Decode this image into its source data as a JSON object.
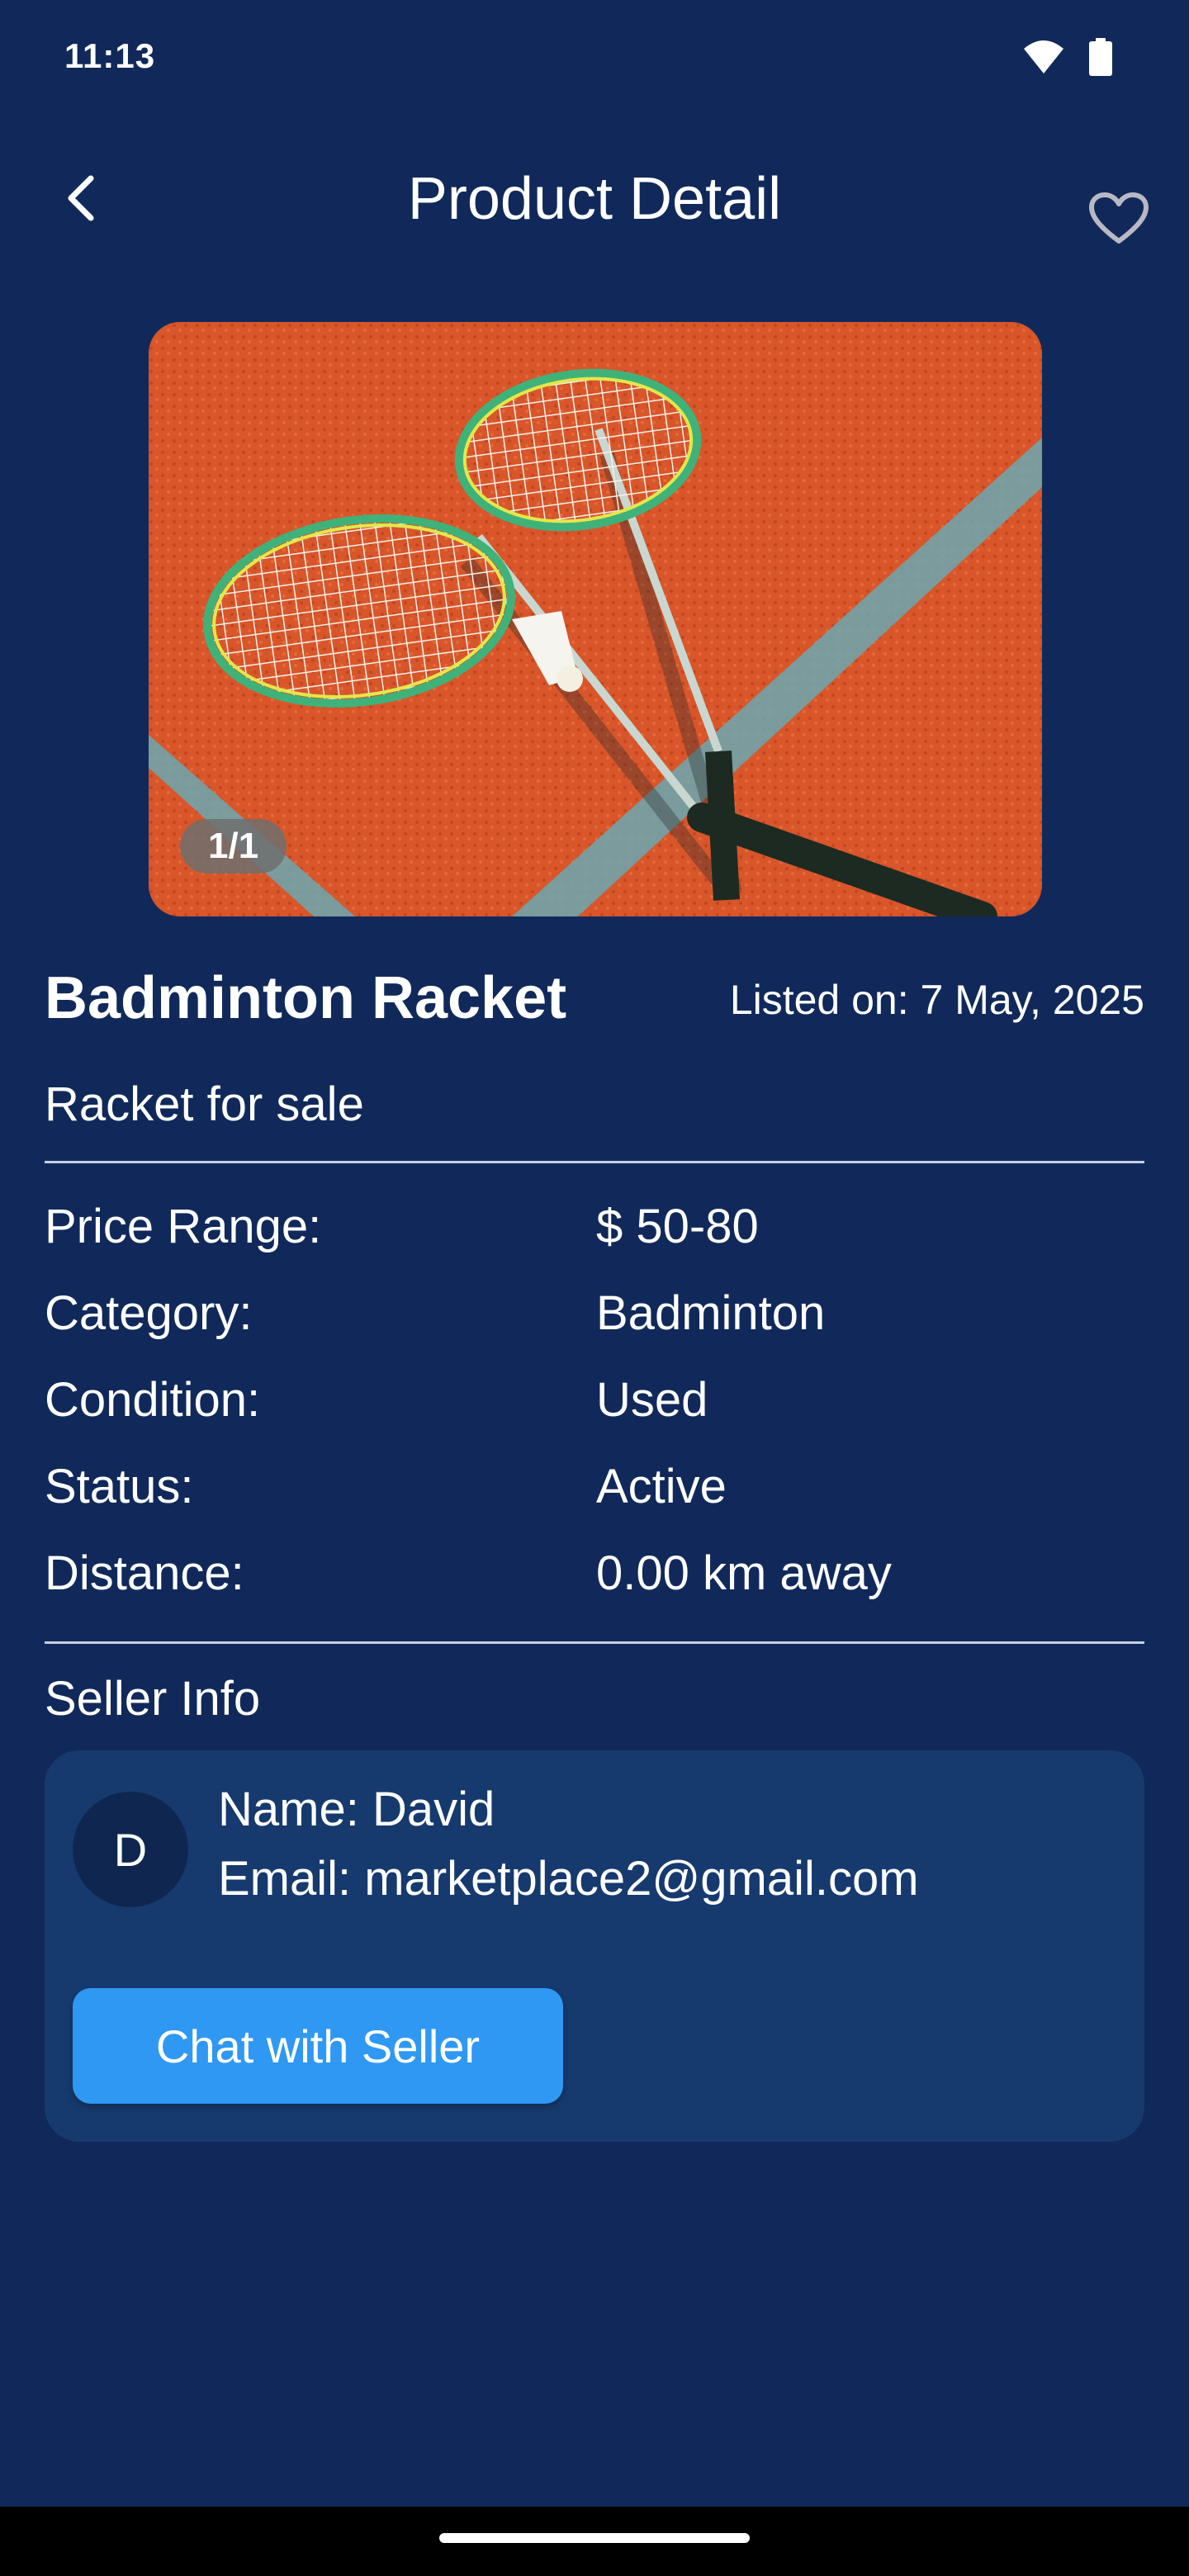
{
  "status_bar": {
    "time": "11:13"
  },
  "header": {
    "title": "Product Detail"
  },
  "image": {
    "counter": "1/1"
  },
  "product": {
    "title": "Badminton Racket",
    "listed_on": "Listed on: 7 May, 2025",
    "subtitle": "Racket for sale"
  },
  "specs": [
    {
      "label": "Price Range:",
      "value": "$ 50-80"
    },
    {
      "label": "Category:",
      "value": "Badminton"
    },
    {
      "label": "Condition:",
      "value": "Used"
    },
    {
      "label": "Status:",
      "value": "Active"
    },
    {
      "label": "Distance:",
      "value": "0.00 km away"
    }
  ],
  "seller": {
    "section_title": "Seller Info",
    "avatar_initial": "D",
    "name": "Name: David",
    "email": "Email: marketplace2@gmail.com",
    "chat_button": "Chat with Seller"
  },
  "colors": {
    "background": "#11295a",
    "card": "#163a6e",
    "accent": "#2f98f3"
  },
  "icons": {
    "back": "chevron-left-icon",
    "favorite": "heart-outline-icon",
    "wifi": "wifi-icon",
    "battery": "battery-icon"
  }
}
